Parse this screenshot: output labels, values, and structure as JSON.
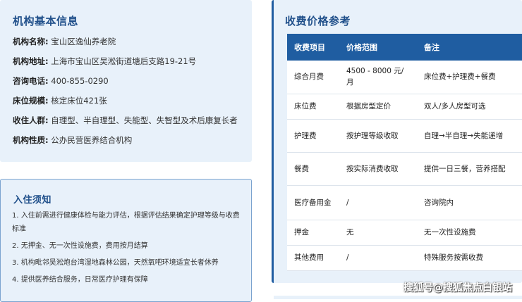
{
  "info": {
    "title": "机构基本信息",
    "rows": [
      {
        "label": "机构名称:",
        "value": "宝山区逸仙养老院"
      },
      {
        "label": "机构地址:",
        "value": "上海市宝山区吴淞街道塘后支路19-21号"
      },
      {
        "label": "咨询电话:",
        "value": "400-855-0290"
      },
      {
        "label": "床位规模:",
        "value": "核定床位421张"
      },
      {
        "label": "收住人群:",
        "value": "自理型、半自理型、失能型、失智型及术后康复长者"
      },
      {
        "label": "机构性质:",
        "value": "公办民营医养结合机构"
      }
    ]
  },
  "notice": {
    "title": "入住须知",
    "items": [
      "1. 入住前需进行健康体检与能力评估，根据评估结果确定护理等级与收费标准",
      "2. 无押金、无一次性设施费，费用按月结算",
      "3. 机构毗邻吴淞炮台湾湿地森林公园，天然氧吧环境适宜长者休养",
      "4. 提供医养结合服务，日常医疗护理有保障"
    ]
  },
  "price": {
    "title": "收费价格参考",
    "headers": [
      "收费项目",
      "价格范围",
      "备注"
    ],
    "rows": [
      {
        "item": "综合月费",
        "range": "4500 - 8000 元/月",
        "note": "床位费+护理费+餐费"
      },
      {
        "item": "床位费",
        "range": "根据房型定价",
        "note": "双人/多人房型可选"
      },
      {
        "item": "护理费",
        "range": "按护理等级收取",
        "note": "自理→半自理→失能递增"
      },
      {
        "item": "餐费",
        "range": "按实际消费收取",
        "note": "提供一日三餐，营养搭配"
      },
      {
        "item": "医疗备用金",
        "range": "/",
        "note": "咨询院内"
      },
      {
        "item": "押金",
        "range": "无",
        "note": "无一次性设施费"
      },
      {
        "item": "其他费用",
        "range": "/",
        "note": "特殊服务按需收费"
      }
    ]
  },
  "watermark": "搜狐号@搜狐焦点白银站",
  "colors": {
    "accent": "#1f5da1",
    "card_bg": "#e8f1fa",
    "title": "#1f4f8a"
  }
}
